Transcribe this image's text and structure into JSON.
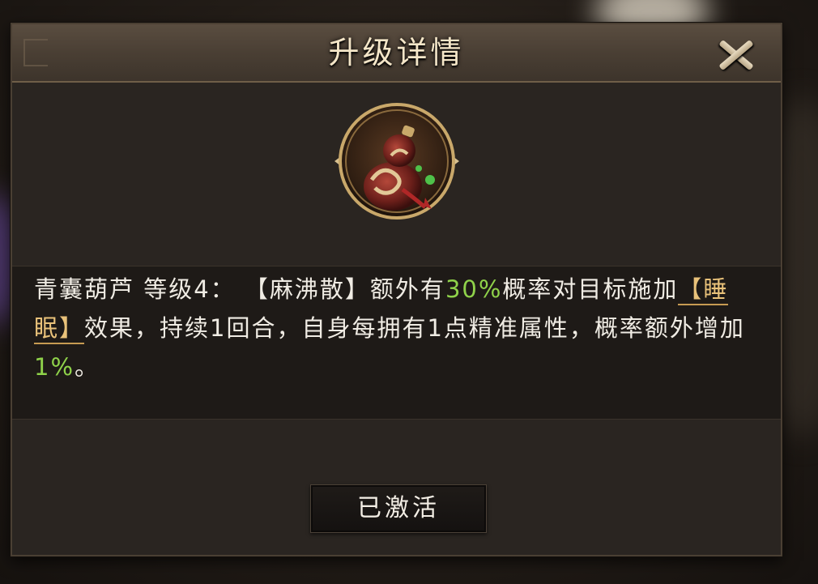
{
  "dialog": {
    "title": "升级详情",
    "item_icon": "gourd-icon",
    "description": {
      "item_name": "青囊葫芦",
      "level_label": "等级4：",
      "skill": "【麻沸散】",
      "text_1": "额外有",
      "chance_1": "30%",
      "text_2": "概率对目标施加",
      "status_effect": "【睡眠】",
      "text_3": "效果，持续1回合，自身每拥有1点精准属性，概率额外增加",
      "chance_2": "1%",
      "text_4": "。"
    },
    "status_button": "已激活"
  },
  "colors": {
    "highlight_green": "#8fd24a",
    "link_gold": "#e9c27a",
    "title_text": "#f4e6c8"
  }
}
